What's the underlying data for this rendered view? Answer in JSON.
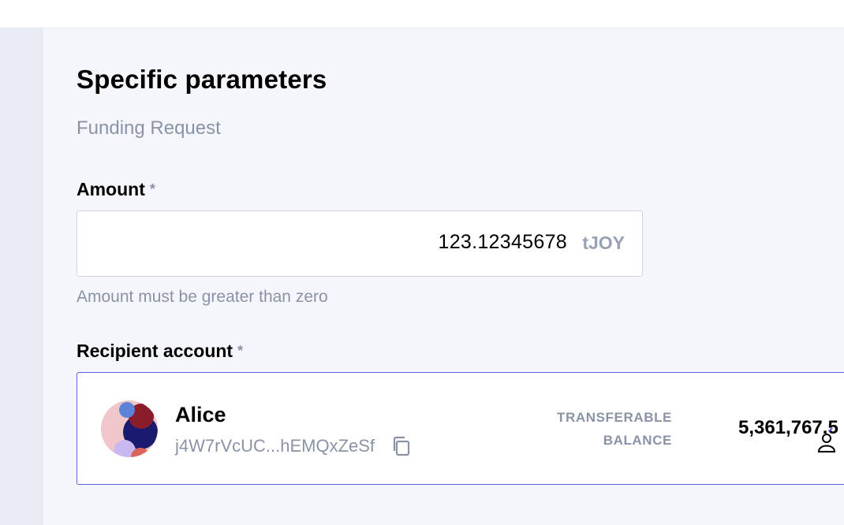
{
  "section": {
    "title": "Specific parameters",
    "subtitle": "Funding Request"
  },
  "amount": {
    "label": "Amount",
    "required_mark": "*",
    "value": "123.12345678",
    "unit": "tJOY",
    "hint": "Amount must be greater than zero"
  },
  "recipient": {
    "label": "Recipient account",
    "required_mark": "*",
    "name": "Alice",
    "address": "j4W7rVcUC...hEMQxZeSf",
    "balance_label_line1": "TRANSFERABLE",
    "balance_label_line2": "BALANCE",
    "balance_value": "5,361,767.5"
  },
  "colors": {
    "accent_border": "#5a5fe0",
    "muted_text": "#8a93a6",
    "page_background": "#f4f6fb"
  },
  "icons": {
    "copy": "copy-icon",
    "avatar": "identicon-avatar",
    "balance": "user-icon"
  }
}
